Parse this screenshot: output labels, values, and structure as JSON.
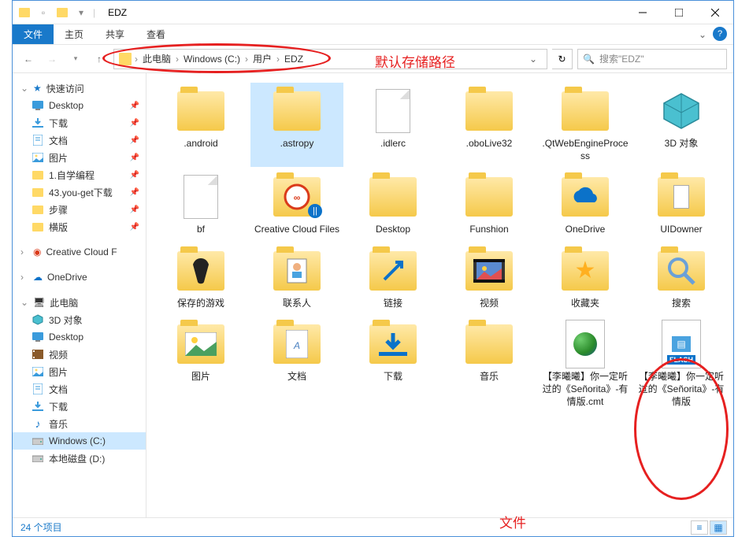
{
  "title": "EDZ",
  "ribbon": {
    "file": "文件",
    "tabs": [
      "主页",
      "共享",
      "查看"
    ]
  },
  "breadcrumbs": [
    "此电脑",
    "Windows (C:)",
    "用户",
    "EDZ"
  ],
  "search_placeholder": "搜索\"EDZ\"",
  "annotations": {
    "path": "默认存储路径",
    "file": "文件"
  },
  "sidebar": {
    "quick": "快速访问",
    "quick_items": [
      {
        "label": "Desktop",
        "icon": "desktop",
        "color": "#3a9bdc"
      },
      {
        "label": "下载",
        "icon": "download",
        "color": "#3a9bdc"
      },
      {
        "label": "文档",
        "icon": "doc",
        "color": "#3a9bdc"
      },
      {
        "label": "图片",
        "icon": "pic",
        "color": "#3a9bdc"
      },
      {
        "label": "1.自学编程",
        "icon": "folder",
        "color": "#ffd966"
      },
      {
        "label": "43.you-get下载",
        "icon": "folder",
        "color": "#ffd966"
      },
      {
        "label": "步骤",
        "icon": "folder",
        "color": "#ffd966"
      },
      {
        "label": "横版",
        "icon": "folder",
        "color": "#ffd966"
      }
    ],
    "cc_files": "Creative Cloud F",
    "onedrive": "OneDrive",
    "thispc": "此电脑",
    "pc_items": [
      {
        "label": "3D 对象",
        "icon": "3d"
      },
      {
        "label": "Desktop",
        "icon": "desktop"
      },
      {
        "label": "视频",
        "icon": "video"
      },
      {
        "label": "图片",
        "icon": "pic"
      },
      {
        "label": "文档",
        "icon": "doc"
      },
      {
        "label": "下载",
        "icon": "download"
      },
      {
        "label": "音乐",
        "icon": "music"
      },
      {
        "label": "Windows (C:)",
        "icon": "drive",
        "selected": true
      },
      {
        "label": "本地磁盘 (D:)",
        "icon": "drive"
      }
    ]
  },
  "items": [
    {
      "label": ".android",
      "type": "folder"
    },
    {
      "label": ".astropy",
      "type": "folder",
      "selected": true
    },
    {
      "label": ".idlerc",
      "type": "file"
    },
    {
      "label": ".oboLive32",
      "type": "folder"
    },
    {
      "label": ".QtWebEngineProcess",
      "type": "folder"
    },
    {
      "label": "3D 对象",
      "type": "3d"
    },
    {
      "label": "bf",
      "type": "file"
    },
    {
      "label": "Creative Cloud Files",
      "type": "cc"
    },
    {
      "label": "Desktop",
      "type": "folder"
    },
    {
      "label": "Funshion",
      "type": "folder"
    },
    {
      "label": "OneDrive",
      "type": "onedrive"
    },
    {
      "label": "UIDowner",
      "type": "uid"
    },
    {
      "label": "保存的游戏",
      "type": "games"
    },
    {
      "label": "联系人",
      "type": "contacts"
    },
    {
      "label": "链接",
      "type": "links"
    },
    {
      "label": "视频",
      "type": "video"
    },
    {
      "label": "收藏夹",
      "type": "fav"
    },
    {
      "label": "搜索",
      "type": "search"
    },
    {
      "label": "图片",
      "type": "pic"
    },
    {
      "label": "文档",
      "type": "doc"
    },
    {
      "label": "下载",
      "type": "download"
    },
    {
      "label": "音乐",
      "type": "folder"
    },
    {
      "label": "【李曦曦】你一定听过的《Señorita》-有情版.cmt",
      "type": "globe"
    },
    {
      "label": "【李曦曦】你一定听过的《Señorita》-有情版",
      "type": "flash"
    }
  ],
  "status": "24 个项目",
  "flash_label": "FLASH"
}
